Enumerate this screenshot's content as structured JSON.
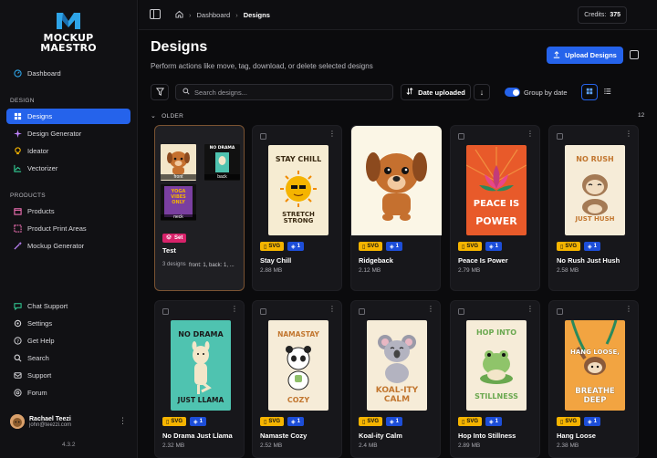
{
  "app": {
    "logo_line1": "MOCKUP",
    "logo_line2": "MAESTRO",
    "version": "4.3.2"
  },
  "sidebar": {
    "dashboard": "Dashboard",
    "section_design": "DESIGN",
    "design_items": [
      {
        "label": "Designs",
        "icon": "designs-icon",
        "active": true
      },
      {
        "label": "Design Generator",
        "icon": "sparkles-icon"
      },
      {
        "label": "Ideator",
        "icon": "lightbulb-icon"
      },
      {
        "label": "Vectorizer",
        "icon": "vector-icon"
      }
    ],
    "section_products": "PRODUCTS",
    "product_items": [
      {
        "label": "Products",
        "icon": "box-icon"
      },
      {
        "label": "Product Print Areas",
        "icon": "print-area-icon"
      },
      {
        "label": "Mockup Generator",
        "icon": "wand-icon"
      }
    ],
    "bottom_items": [
      {
        "label": "Chat Support",
        "icon": "chat-icon"
      },
      {
        "label": "Settings",
        "icon": "gear-icon"
      },
      {
        "label": "Get Help",
        "icon": "help-icon"
      },
      {
        "label": "Search",
        "icon": "search-icon"
      },
      {
        "label": "Support",
        "icon": "support-icon"
      },
      {
        "label": "Forum",
        "icon": "forum-icon"
      }
    ],
    "user": {
      "name": "Rachael Teezi",
      "email": "john@teezzi.com"
    }
  },
  "topbar": {
    "breadcrumb": [
      "Dashboard",
      "Designs"
    ],
    "credits_label": "Credits:",
    "credits_value": "375"
  },
  "main": {
    "title": "Designs",
    "subtitle": "Perform actions like move, tag, download, or delete selected designs",
    "upload_label": "Upload Designs",
    "search_placeholder": "Search designs...",
    "sort_label": "Date uploaded",
    "group_toggle_label": "Group by date",
    "group_name": "OLDER",
    "group_count": "12"
  },
  "set_card": {
    "badge": "Set",
    "name": "Test",
    "count": "3 designs",
    "detail": "front: 1, back: 1, ...",
    "minis": [
      {
        "label": "front"
      },
      {
        "label": "back",
        "text": "NO DRAMA"
      },
      {
        "label": "neck",
        "text": "YOGA VIBES ONLY"
      }
    ]
  },
  "designs": [
    {
      "name": "Stay Chill",
      "size": "2.88 MB",
      "format": "SVG",
      "count": "1",
      "poster_top": "STAY CHILL",
      "poster_bottom": "STRETCH STRONG",
      "bg": "#f6ecd2"
    },
    {
      "name": "Ridgeback",
      "size": "2.12 MB",
      "format": "SVG",
      "count": "1",
      "bg": "#fbf6e6"
    },
    {
      "name": "Peace Is Power",
      "size": "2.79 MB",
      "format": "SVG",
      "count": "1",
      "poster_top": "PEACE IS",
      "poster_bottom": "POWER",
      "bg": "#e85a2a"
    },
    {
      "name": "No Rush Just Hush",
      "size": "2.58 MB",
      "format": "SVG",
      "count": "1",
      "poster_top": "NO RUSH",
      "poster_bottom": "JUST HUSH",
      "bg": "#f6ecd8"
    },
    {
      "name": "No Drama Just Llama",
      "size": "2.32 MB",
      "format": "SVG",
      "count": "1",
      "poster_top": "NO DRAMA",
      "poster_bottom": "JUST LLAMA",
      "bg": "#4fc3b0"
    },
    {
      "name": "Namaste Cozy",
      "size": "2.52 MB",
      "format": "SVG",
      "count": "1",
      "poster_top": "NAMASTAY",
      "poster_bottom": "COZY",
      "bg": "#f6ecd8"
    },
    {
      "name": "Koal-ity Calm",
      "size": "2.4 MB",
      "format": "SVG",
      "count": "1",
      "poster_top": "",
      "poster_bottom": "KOAL-ITY CALM",
      "bg": "#f6ecd8"
    },
    {
      "name": "Hop Into Stillness",
      "size": "2.89 MB",
      "format": "SVG",
      "count": "1",
      "poster_top": "HOP INTO",
      "poster_bottom": "STILLNESS",
      "bg": "#f6ecd8"
    },
    {
      "name": "Hang Loose",
      "size": "2.38 MB",
      "format": "SVG",
      "count": "1",
      "poster_top": "HANG LOOSE,",
      "poster_bottom": "BREATHE DEEP",
      "bg": "#f2a441"
    }
  ]
}
